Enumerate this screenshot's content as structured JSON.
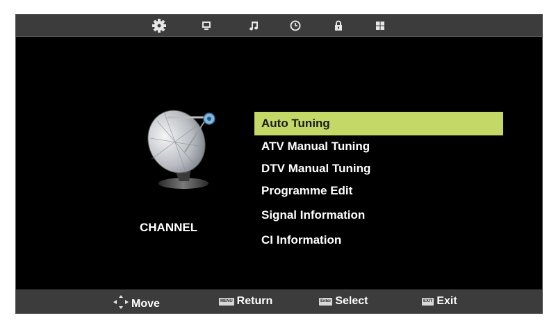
{
  "top_tabs": [
    {
      "icon": "gear-icon",
      "active": true
    },
    {
      "icon": "monitor-icon",
      "active": false
    },
    {
      "icon": "music-note-icon",
      "active": false
    },
    {
      "icon": "clock-icon",
      "active": false
    },
    {
      "icon": "lock-icon",
      "active": false
    },
    {
      "icon": "grid-icon",
      "active": false
    }
  ],
  "category": {
    "label": "CHANNEL",
    "icon": "satellite-dish-icon"
  },
  "menu": {
    "items": [
      {
        "label": "Auto Tuning",
        "selected": true
      },
      {
        "label": "ATV Manual Tuning",
        "selected": false
      },
      {
        "label": "DTV Manual Tuning",
        "selected": false
      },
      {
        "label": "Programme Edit",
        "selected": false
      },
      {
        "label": "Signal  Information",
        "selected": false
      },
      {
        "label": "CI  Information",
        "selected": false
      }
    ],
    "highlight_color": "#c4d868"
  },
  "footer": {
    "move": {
      "label": "Move",
      "icon": "dpad-arrows-icon"
    },
    "return": {
      "label": "Return",
      "key": "MENU"
    },
    "select": {
      "label": "Select",
      "key": "Enter"
    },
    "exit": {
      "label": "Exit",
      "key": "EXIT"
    }
  }
}
